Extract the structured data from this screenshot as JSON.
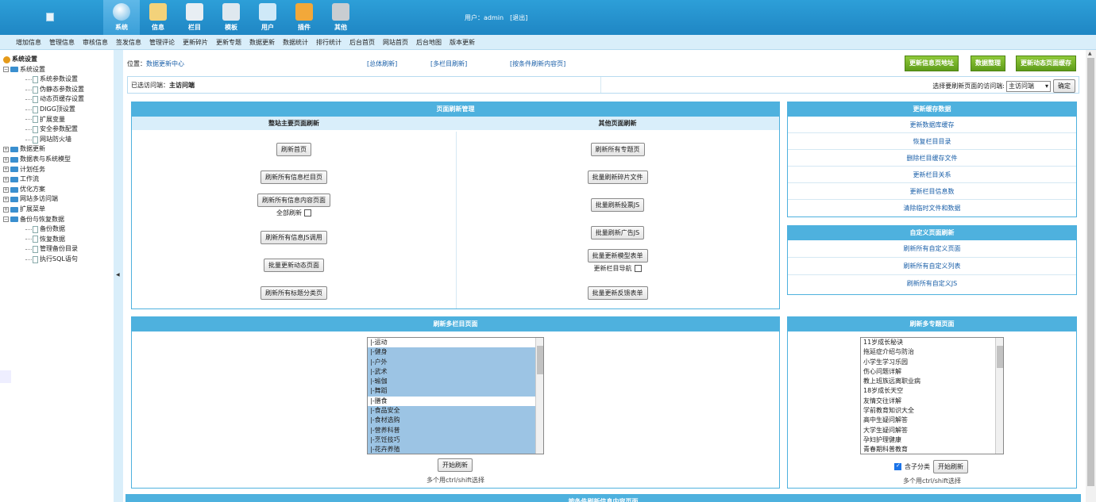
{
  "header": {
    "nav": [
      {
        "label": "系统",
        "icon": "system-icon",
        "color": "#ffffff",
        "active": true
      },
      {
        "label": "信息",
        "icon": "notepad-icon",
        "color": "#f3d27a"
      },
      {
        "label": "栏目",
        "icon": "folder-icon",
        "color": "#e8eef3"
      },
      {
        "label": "模板",
        "icon": "template-icon",
        "color": "#dfe8ef"
      },
      {
        "label": "用户",
        "icon": "user-icon",
        "color": "#cfe9f8"
      },
      {
        "label": "插件",
        "icon": "tools-icon",
        "color": "#f2a83a"
      },
      {
        "label": "其他",
        "icon": "gear-icon",
        "color": "#c9cdd1"
      }
    ],
    "user_label": "用户：admin",
    "logout": "[退出]"
  },
  "submenu": [
    "增加信息",
    "管理信息",
    "审核信息",
    "签发信息",
    "管理评论",
    "更新碎片",
    "更新专题",
    "数据更新",
    "数据统计",
    "排行统计",
    "后台首页",
    "网站首页",
    "后台地图",
    "版本更新"
  ],
  "tree": {
    "root": "系统设置",
    "rows": [
      {
        "label": "系统设置",
        "type": "open"
      },
      {
        "label": "系统参数设置",
        "type": "child"
      },
      {
        "label": "伪静态参数设置",
        "type": "child"
      },
      {
        "label": "动态页缓存设置",
        "type": "child"
      },
      {
        "label": "DIGG顶设置",
        "type": "child"
      },
      {
        "label": "扩展变量",
        "type": "child"
      },
      {
        "label": "安全参数配置",
        "type": "child"
      },
      {
        "label": "网站防火墙",
        "type": "child"
      },
      {
        "label": "数据更新",
        "type": "closed"
      },
      {
        "label": "数据表与系统模型",
        "type": "closed"
      },
      {
        "label": "计划任务",
        "type": "closed"
      },
      {
        "label": "工作流",
        "type": "closed"
      },
      {
        "label": "优化方案",
        "type": "closed"
      },
      {
        "label": "网站多访问端",
        "type": "closed"
      },
      {
        "label": "扩展菜单",
        "type": "closed"
      },
      {
        "label": "备份与恢复数据",
        "type": "open"
      },
      {
        "label": "备份数据",
        "type": "child"
      },
      {
        "label": "恢复数据",
        "type": "child"
      },
      {
        "label": "管理备份目录",
        "type": "child"
      },
      {
        "label": "执行SQL语句",
        "type": "child"
      }
    ]
  },
  "main": {
    "location_prefix": "位置：",
    "location_link": "数据更新中心",
    "top_links": [
      "[总体刷新]",
      "[多栏目刷新]",
      "[按条件刷新内容页]"
    ],
    "green_buttons": [
      "更新信息页地址",
      "数据整理",
      "更新动态页面缓存"
    ],
    "visit_prefix": "已选访问端：",
    "visit_value": "主访问端",
    "visit_select_label": "选择要刷新页面的访问端:",
    "visit_select_value": "主访问端",
    "confirm": "确定"
  },
  "page_refresh": {
    "title": "页面刷新管理",
    "left_head": "整站主要页面刷新",
    "right_head": "其他页面刷新",
    "left_buttons": [
      "刷新首页",
      "刷新所有信息栏目页",
      "刷新所有信息内容页面",
      "刷新所有信息JS调用",
      "批量更新动态页面",
      "刷新所有标题分类页"
    ],
    "all_refresh": "全部刷新",
    "right_buttons": [
      "刷新所有专题页",
      "批量刷新碎片文件",
      "批量刷新投票JS",
      "批量刷新广告JS",
      "批量更新模型表单",
      "批量更新反馈表单"
    ],
    "nav_update": "更新栏目导航"
  },
  "cache": {
    "title": "更新缓存数据",
    "items": [
      "更新数据库缓存",
      "恢复栏目目录",
      "删除栏目缓存文件",
      "更新栏目关系",
      "更新栏目信息数",
      "清除临时文件和数据"
    ]
  },
  "custom": {
    "title": "自定义页面刷新",
    "items": [
      "刷新所有自定义页面",
      "刷新所有自定义列表",
      "刷新所有自定义JS"
    ]
  },
  "multi_column": {
    "title": "刷新多栏目页面",
    "options": [
      {
        "label": "|-运动",
        "selected": false
      },
      {
        "label": "|-健身",
        "selected": true
      },
      {
        "label": "|-户外",
        "selected": true
      },
      {
        "label": "|-武术",
        "selected": true
      },
      {
        "label": "|-瑜伽",
        "selected": true
      },
      {
        "label": "|-舞蹈",
        "selected": true
      },
      {
        "label": "|-膳食",
        "selected": false
      },
      {
        "label": "|-食品安全",
        "selected": true
      },
      {
        "label": "|-食材选购",
        "selected": true
      },
      {
        "label": "|-营养科普",
        "selected": true
      },
      {
        "label": "|-烹饪技巧",
        "selected": true
      },
      {
        "label": "|-花卉养殖",
        "selected": true
      }
    ],
    "start": "开始刷新",
    "note": "多个用ctrl/shift选择"
  },
  "multi_topic": {
    "title": "刷新多专题页面",
    "options": [
      "11岁成长秘诀",
      "拖延症介绍与防治",
      "小学生学习乐园",
      "伤心问题详解",
      "教上班族远离职业病",
      "18岁成长天空",
      "友情交往详解",
      "学前教育知识大全",
      "高中生疑问解答",
      "大学生疑问解答",
      "孕妇护理健康",
      "青春期科普教育"
    ],
    "include_sub": "含子分类",
    "start": "开始刷新",
    "note": "多个用ctrl/shift选择"
  },
  "bottom_panel_title": "按条件刷新信息内容页面"
}
